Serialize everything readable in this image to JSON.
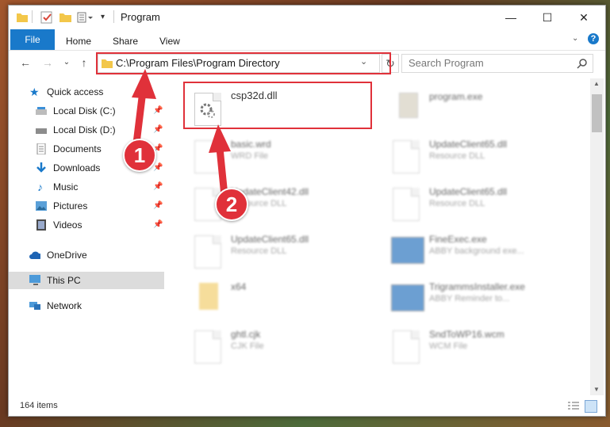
{
  "window": {
    "title": "Program",
    "controls": {
      "minimize": "—",
      "maximize": "☐",
      "close": "✕"
    }
  },
  "ribbon": {
    "tabs": [
      "File",
      "Home",
      "Share",
      "View"
    ],
    "help_icon": "?"
  },
  "address_bar": {
    "path": "C:\\Program Files\\Program Directory",
    "search_placeholder": "Search Program"
  },
  "nav_pane": {
    "quick_access": "Quick access",
    "items": [
      {
        "label": "Local Disk (C:)",
        "icon": "drive-icon",
        "pinned": true
      },
      {
        "label": "Local Disk (D:)",
        "icon": "drive-icon",
        "pinned": true
      },
      {
        "label": "Documents",
        "icon": "documents-icon",
        "pinned": true
      },
      {
        "label": "Downloads",
        "icon": "downloads-icon",
        "pinned": true
      },
      {
        "label": "Music",
        "icon": "music-icon",
        "pinned": true
      },
      {
        "label": "Pictures",
        "icon": "pictures-icon",
        "pinned": true
      },
      {
        "label": "Videos",
        "icon": "videos-icon",
        "pinned": true
      }
    ],
    "onedrive": "OneDrive",
    "this_pc": "This PC",
    "network": "Network"
  },
  "files": [
    {
      "name": "csp32d.dll",
      "desc": ""
    },
    {
      "name": "program.exe",
      "desc": ""
    },
    {
      "name": "basic.wrd",
      "desc": "WRD File"
    },
    {
      "name": "UpdateClient65.dll",
      "desc": "Resource DLL"
    },
    {
      "name": "UpdateClient42.dll",
      "desc": "Resource DLL"
    },
    {
      "name": "UpdateClient65.dll",
      "desc": "Resource DLL"
    },
    {
      "name": "UpdateClient65.dll",
      "desc": "Resource DLL"
    },
    {
      "name": "FineExec.exe",
      "desc": "ABBY background exe..."
    },
    {
      "name": "x64",
      "desc": ""
    },
    {
      "name": "TrigrammsInstaller.exe",
      "desc": "ABBY Reminder to..."
    },
    {
      "name": "ghtl.cjk",
      "desc": "CJK File"
    },
    {
      "name": "SndToWP16.wcm",
      "desc": "WCM File"
    }
  ],
  "status": {
    "item_count": "164 items"
  },
  "annotations": {
    "step1": "1",
    "step2": "2"
  },
  "colors": {
    "accent": "#1979ca",
    "annotation": "#e0313a"
  }
}
